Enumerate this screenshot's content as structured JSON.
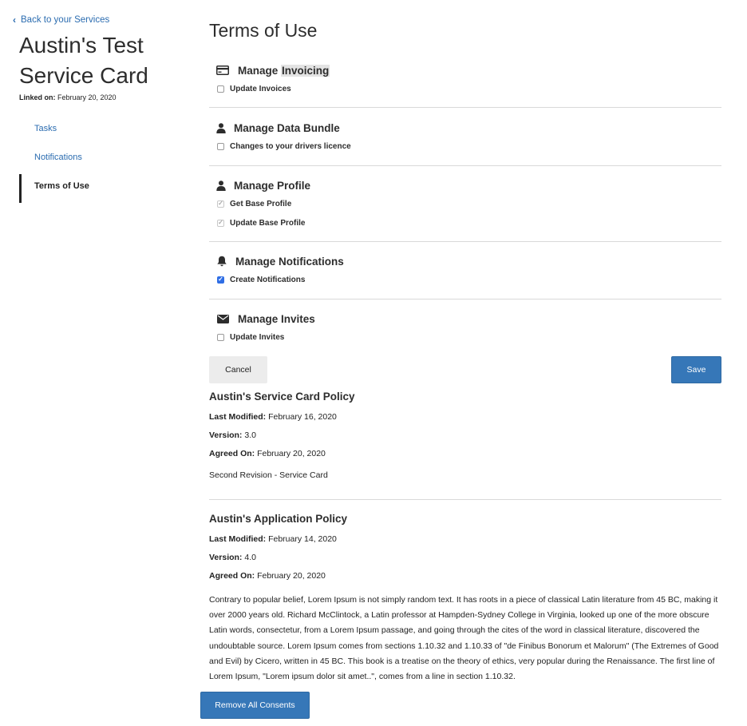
{
  "sidebar": {
    "back_label": "Back to your Services",
    "service_title": "Austin's Test Service Card",
    "linked_on_label": "Linked on:",
    "linked_on_value": "February 20, 2020",
    "nav": [
      {
        "label": "Tasks"
      },
      {
        "label": "Notifications"
      },
      {
        "label": "Terms of Use"
      }
    ]
  },
  "main": {
    "title": "Terms of Use",
    "groups": [
      {
        "title_prefix": "Manage ",
        "title_highlight": "Invoicing",
        "icon": "credit-card-icon",
        "permissions": [
          {
            "label": "Update Invoices",
            "state": "unchecked"
          }
        ]
      },
      {
        "title": "Manage Data Bundle",
        "icon": "user-icon",
        "permissions": [
          {
            "label": "Changes to your drivers licence",
            "state": "unchecked"
          }
        ]
      },
      {
        "title": "Manage Profile",
        "icon": "user-icon",
        "permissions": [
          {
            "label": "Get Base Profile",
            "state": "checked-disabled"
          },
          {
            "label": "Update Base Profile",
            "state": "checked-disabled"
          }
        ]
      },
      {
        "title": "Manage Notifications",
        "icon": "bell-icon",
        "permissions": [
          {
            "label": "Create Notifications",
            "state": "checked"
          }
        ]
      },
      {
        "title": "Manage Invites",
        "icon": "envelope-icon",
        "permissions": [
          {
            "label": "Update Invites",
            "state": "unchecked"
          }
        ]
      }
    ],
    "cancel_label": "Cancel",
    "save_label": "Save",
    "policies": [
      {
        "title": "Austin's Service Card Policy",
        "last_modified_label": "Last Modified:",
        "last_modified": "February 16, 2020",
        "version_label": "Version:",
        "version": "3.0",
        "agreed_on_label": "Agreed On:",
        "agreed_on": "February 20, 2020",
        "description": "Second Revision - Service Card"
      },
      {
        "title": "Austin's Application Policy",
        "last_modified_label": "Last Modified:",
        "last_modified": "February 14, 2020",
        "version_label": "Version:",
        "version": "4.0",
        "agreed_on_label": "Agreed On:",
        "agreed_on": "February 20, 2020",
        "description": "Contrary to popular belief, Lorem Ipsum is not simply random text. It has roots in a piece of classical Latin literature from 45 BC, making it over 2000 years old. Richard McClintock, a Latin professor at Hampden-Sydney College in Virginia, looked up one of the more obscure Latin words, consectetur, from a Lorem Ipsum passage, and going through the cites of the word in classical literature, discovered the undoubtable source. Lorem Ipsum comes from sections 1.10.32 and 1.10.33 of \"de Finibus Bonorum et Malorum\" (The Extremes of Good and Evil) by Cicero, written in 45 BC. This book is a treatise on the theory of ethics, very popular during the Renaissance. The first line of Lorem Ipsum, \"Lorem ipsum dolor sit amet..\", comes from a line in section 1.10.32."
      }
    ],
    "remove_all_label": "Remove All Consents"
  },
  "colors": {
    "link": "#2b6cb0",
    "primary_button": "#3677b8",
    "checkbox_checked": "#2f6ee5"
  }
}
